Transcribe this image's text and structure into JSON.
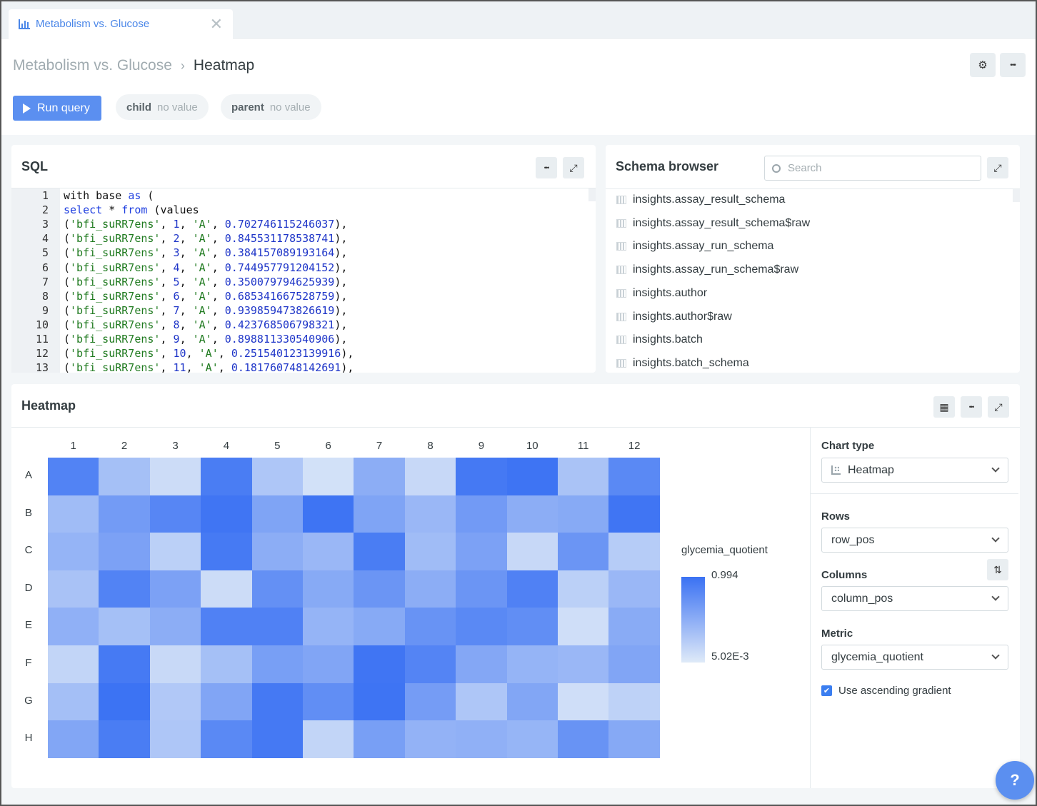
{
  "tab": {
    "title": "Metabolism vs. Glucose",
    "icon": "bar-chart-icon",
    "close_icon": "close-icon"
  },
  "breadcrumb": {
    "parent": "Metabolism vs. Glucose",
    "separator": "›",
    "current": "Heatmap"
  },
  "header_actions": {
    "settings_icon": "⚙",
    "more_icon": "•••"
  },
  "toolbar": {
    "run_label": "Run query"
  },
  "parameters": [
    {
      "name": "child",
      "value": "no value"
    },
    {
      "name": "parent",
      "value": "no value"
    }
  ],
  "sql_panel": {
    "title": "SQL",
    "more_icon": "•••",
    "expand_icon": "⤢",
    "lines": [
      {
        "n": "1",
        "html": "with base <span class='kw'>as</span> ("
      },
      {
        "n": "2",
        "html": "<span class='kw'>select</span> * <span class='kw'>from</span> (values"
      },
      {
        "n": "3",
        "html": "(<span class='str'>'bfi_suRR7ens'</span>, <span class='num'>1</span>, <span class='str'>'A'</span>, <span class='num'>0.702746115246037</span>),"
      },
      {
        "n": "4",
        "html": "(<span class='str'>'bfi_suRR7ens'</span>, <span class='num'>2</span>, <span class='str'>'A'</span>, <span class='num'>0.845531178538741</span>),"
      },
      {
        "n": "5",
        "html": "(<span class='str'>'bfi_suRR7ens'</span>, <span class='num'>3</span>, <span class='str'>'A'</span>, <span class='num'>0.384157089193164</span>),"
      },
      {
        "n": "6",
        "html": "(<span class='str'>'bfi_suRR7ens'</span>, <span class='num'>4</span>, <span class='str'>'A'</span>, <span class='num'>0.744957791204152</span>),"
      },
      {
        "n": "7",
        "html": "(<span class='str'>'bfi_suRR7ens'</span>, <span class='num'>5</span>, <span class='str'>'A'</span>, <span class='num'>0.350079794625939</span>),"
      },
      {
        "n": "8",
        "html": "(<span class='str'>'bfi_suRR7ens'</span>, <span class='num'>6</span>, <span class='str'>'A'</span>, <span class='num'>0.685341667528759</span>),"
      },
      {
        "n": "9",
        "html": "(<span class='str'>'bfi_suRR7ens'</span>, <span class='num'>7</span>, <span class='str'>'A'</span>, <span class='num'>0.939859473826619</span>),"
      },
      {
        "n": "10",
        "html": "(<span class='str'>'bfi_suRR7ens'</span>, <span class='num'>8</span>, <span class='str'>'A'</span>, <span class='num'>0.423768506798321</span>),"
      },
      {
        "n": "11",
        "html": "(<span class='str'>'bfi_suRR7ens'</span>, <span class='num'>9</span>, <span class='str'>'A'</span>, <span class='num'>0.898811330540906</span>),"
      },
      {
        "n": "12",
        "html": "(<span class='str'>'bfi_suRR7ens'</span>, <span class='num'>10</span>, <span class='str'>'A'</span>, <span class='num'>0.251540123139916</span>),"
      },
      {
        "n": "13",
        "html": "(<span class='str'>'bfi_suRR7ens'</span>, <span class='num'>11</span>, <span class='str'>'A'</span>, <span class='num'>0.181760748142691</span>),"
      }
    ]
  },
  "schema_panel": {
    "title": "Schema browser",
    "search_placeholder": "Search",
    "expand_icon": "⤢",
    "items": [
      "insights.assay_result_schema",
      "insights.assay_result_schema$raw",
      "insights.assay_run_schema",
      "insights.assay_run_schema$raw",
      "insights.author",
      "insights.author$raw",
      "insights.batch",
      "insights.batch_schema"
    ]
  },
  "heatmap_panel": {
    "title": "Heatmap",
    "table_icon": "▦",
    "more_icon": "•••",
    "expand_icon": "⤢"
  },
  "colors": {
    "accent": "#5b8ff0",
    "heat_high": "#3a71f3",
    "heat_low": "#dfeaf8"
  },
  "chart_data": {
    "type": "heatmap",
    "title": "",
    "x_labels": [
      "1",
      "2",
      "3",
      "4",
      "5",
      "6",
      "7",
      "8",
      "9",
      "10",
      "11",
      "12"
    ],
    "y_labels": [
      "A",
      "B",
      "C",
      "D",
      "E",
      "F",
      "G",
      "H"
    ],
    "values": [
      [
        0.85,
        0.35,
        0.12,
        0.9,
        0.3,
        0.08,
        0.5,
        0.15,
        0.93,
        0.97,
        0.32,
        0.8
      ],
      [
        0.38,
        0.65,
        0.82,
        0.96,
        0.58,
        0.97,
        0.58,
        0.42,
        0.66,
        0.5,
        0.53,
        0.96
      ],
      [
        0.45,
        0.6,
        0.22,
        0.92,
        0.5,
        0.42,
        0.9,
        0.38,
        0.6,
        0.15,
        0.7,
        0.25
      ],
      [
        0.33,
        0.85,
        0.6,
        0.12,
        0.74,
        0.53,
        0.7,
        0.5,
        0.7,
        0.86,
        0.22,
        0.42
      ],
      [
        0.48,
        0.35,
        0.5,
        0.86,
        0.86,
        0.45,
        0.53,
        0.72,
        0.8,
        0.76,
        0.1,
        0.52
      ],
      [
        0.18,
        0.92,
        0.14,
        0.35,
        0.62,
        0.57,
        0.96,
        0.84,
        0.55,
        0.45,
        0.42,
        0.57
      ],
      [
        0.36,
        0.98,
        0.28,
        0.57,
        0.93,
        0.76,
        0.97,
        0.64,
        0.3,
        0.56,
        0.1,
        0.2
      ],
      [
        0.56,
        0.9,
        0.3,
        0.8,
        0.93,
        0.18,
        0.62,
        0.46,
        0.48,
        0.44,
        0.72,
        0.54
      ]
    ],
    "legend": {
      "title": "glycemia_quotient",
      "max_label": "0.994",
      "min_label": "5.02E-3",
      "max": 0.994,
      "min": 0.00502,
      "placement": "right"
    }
  },
  "config": {
    "chart_type_label": "Chart type",
    "chart_type_value": "Heatmap",
    "rows_label": "Rows",
    "rows_value": "row_pos",
    "columns_label": "Columns",
    "columns_value": "column_pos",
    "swap_icon": "⇅",
    "metric_label": "Metric",
    "metric_value": "glycemia_quotient",
    "ascending_label": "Use ascending gradient",
    "ascending_checked": true
  },
  "help": {
    "label": "?"
  }
}
